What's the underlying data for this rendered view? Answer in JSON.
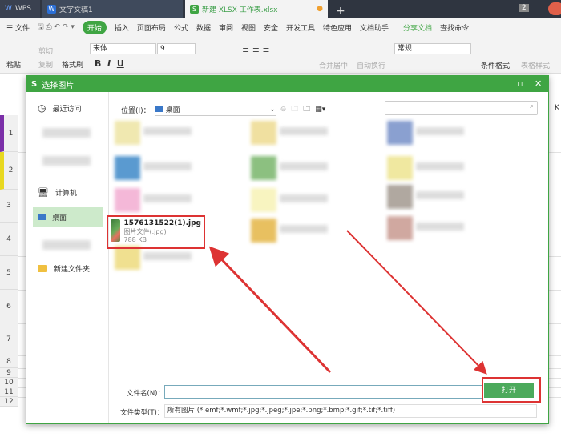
{
  "tabs": [
    {
      "label": "WPS"
    },
    {
      "label": "文字文稿1"
    },
    {
      "label": "新建 XLSX 工作表.xlsx"
    }
  ],
  "tab_badge": "2",
  "menu": {
    "file": "文件",
    "items": [
      "开始",
      "插入",
      "页面布局",
      "公式",
      "数据",
      "审阅",
      "视图",
      "安全",
      "开发工具",
      "特色应用",
      "文档助手"
    ],
    "share": "分享文档",
    "find": "查找命令"
  },
  "toolbar": {
    "paste": "粘贴",
    "cut": "剪切",
    "copy": "复制",
    "format_painter": "格式刷",
    "font": "宋体",
    "size": "9",
    "merge": "合并居中",
    "wrap": "自动换行",
    "number_format": "常规",
    "cond_format": "条件格式",
    "table_style": "表格样式"
  },
  "rows": [
    "1",
    "2",
    "3",
    "4",
    "5",
    "6",
    "7",
    "8",
    "9",
    "10",
    "11",
    "12"
  ],
  "column_k": "K",
  "dialog": {
    "title": "选择图片",
    "sidebar": [
      {
        "label": "最近访问",
        "icon": "clock-icon"
      },
      {
        "label": "计算机",
        "icon": "computer-icon"
      },
      {
        "label": "桌面",
        "icon": "desktop-icon"
      },
      {
        "label": "新建文件夹",
        "icon": "folder-icon"
      }
    ],
    "location_label": "位置(I)：",
    "location_value": "桌面",
    "selected_file": {
      "name": "1576131522(1).jpg",
      "type": "图片文件(.jpg)",
      "size": "788 KB"
    },
    "filename_label": "文件名(N)：",
    "filename_value": "",
    "filetype_label": "文件类型(T)：",
    "filetype_value": "所有图片 (*.emf;*.wmf;*.jpg;*.jpeg;*.jpe;*.png;*.bmp;*.gif;*.tif;*.tiff)",
    "open_button": "打开"
  },
  "colors": {
    "accent": "#3fa543",
    "highlight": "#d33333"
  }
}
